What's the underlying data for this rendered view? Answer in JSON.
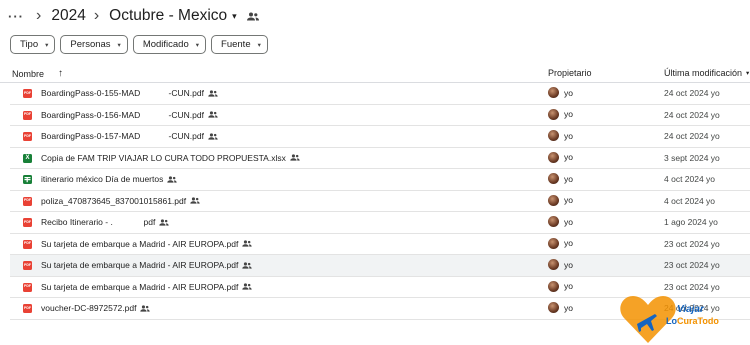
{
  "breadcrumb": {
    "more": "···",
    "sep": "›",
    "year": "2024",
    "folder": "Octubre - Mexico",
    "folder_caret": "▾"
  },
  "filters": [
    {
      "label": "Tipo"
    },
    {
      "label": "Personas"
    },
    {
      "label": "Modificado"
    },
    {
      "label": "Fuente"
    }
  ],
  "filter_caret": "▾",
  "table": {
    "col_name": "Nombre",
    "sort_arrow": "↑",
    "col_owner": "Propietario",
    "col_modified": "Última modificación",
    "mod_caret": "▾"
  },
  "files": [
    {
      "name": "BoardingPass-0-155-MAD            -CUN.pdf",
      "type": "pdf",
      "shared": true,
      "owner": "yo",
      "modified": "24 oct 2024 yo"
    },
    {
      "name": "BoardingPass-0-156-MAD            -CUN.pdf",
      "type": "pdf",
      "shared": true,
      "owner": "yo",
      "modified": "24 oct 2024 yo"
    },
    {
      "name": "BoardingPass-0-157-MAD            -CUN.pdf",
      "type": "pdf",
      "shared": true,
      "owner": "yo",
      "modified": "24 oct 2024 yo"
    },
    {
      "name": "Copia de FAM TRIP VIAJAR LO CURA TODO PROPUESTA.xlsx",
      "type": "xlsx",
      "shared": true,
      "owner": "yo",
      "modified": "3 sept 2024 yo"
    },
    {
      "name": "itinerario méxico Día de muertos",
      "type": "sheets",
      "shared": true,
      "owner": "yo",
      "modified": "4 oct 2024 yo"
    },
    {
      "name": "poliza_470873645_837001015861.pdf",
      "type": "pdf",
      "shared": true,
      "owner": "yo",
      "modified": "4 oct 2024 yo"
    },
    {
      "name": "Recibo Itinerario - .             pdf",
      "type": "pdf",
      "shared": true,
      "owner": "yo",
      "modified": "1 ago 2024 yo"
    },
    {
      "name": "Su tarjeta de embarque a Madrid - AIR EUROPA.pdf",
      "type": "pdf",
      "shared": true,
      "owner": "yo",
      "modified": "23 oct 2024 yo"
    },
    {
      "name": "Su tarjeta de embarque a Madrid - AIR EUROPA.pdf",
      "type": "pdf",
      "shared": true,
      "owner": "yo",
      "modified": "23 oct 2024 yo",
      "selected": true
    },
    {
      "name": "Su tarjeta de embarque a Madrid - AIR EUROPA.pdf",
      "type": "pdf",
      "shared": true,
      "owner": "yo",
      "modified": "23 oct 2024 yo"
    },
    {
      "name": "voucher-DC-8972572.pdf",
      "type": "pdf",
      "shared": true,
      "owner": "yo",
      "modified": "24 oct 2024 yo"
    }
  ],
  "watermark": {
    "line1": "Viajar",
    "line2_a": "Lo",
    "line2_b": "CuraTodo"
  },
  "colors": {
    "pdf": "#e94235",
    "sheets": "#188038",
    "logo_orange": "#f39200",
    "logo_blue": "#1565c0"
  }
}
